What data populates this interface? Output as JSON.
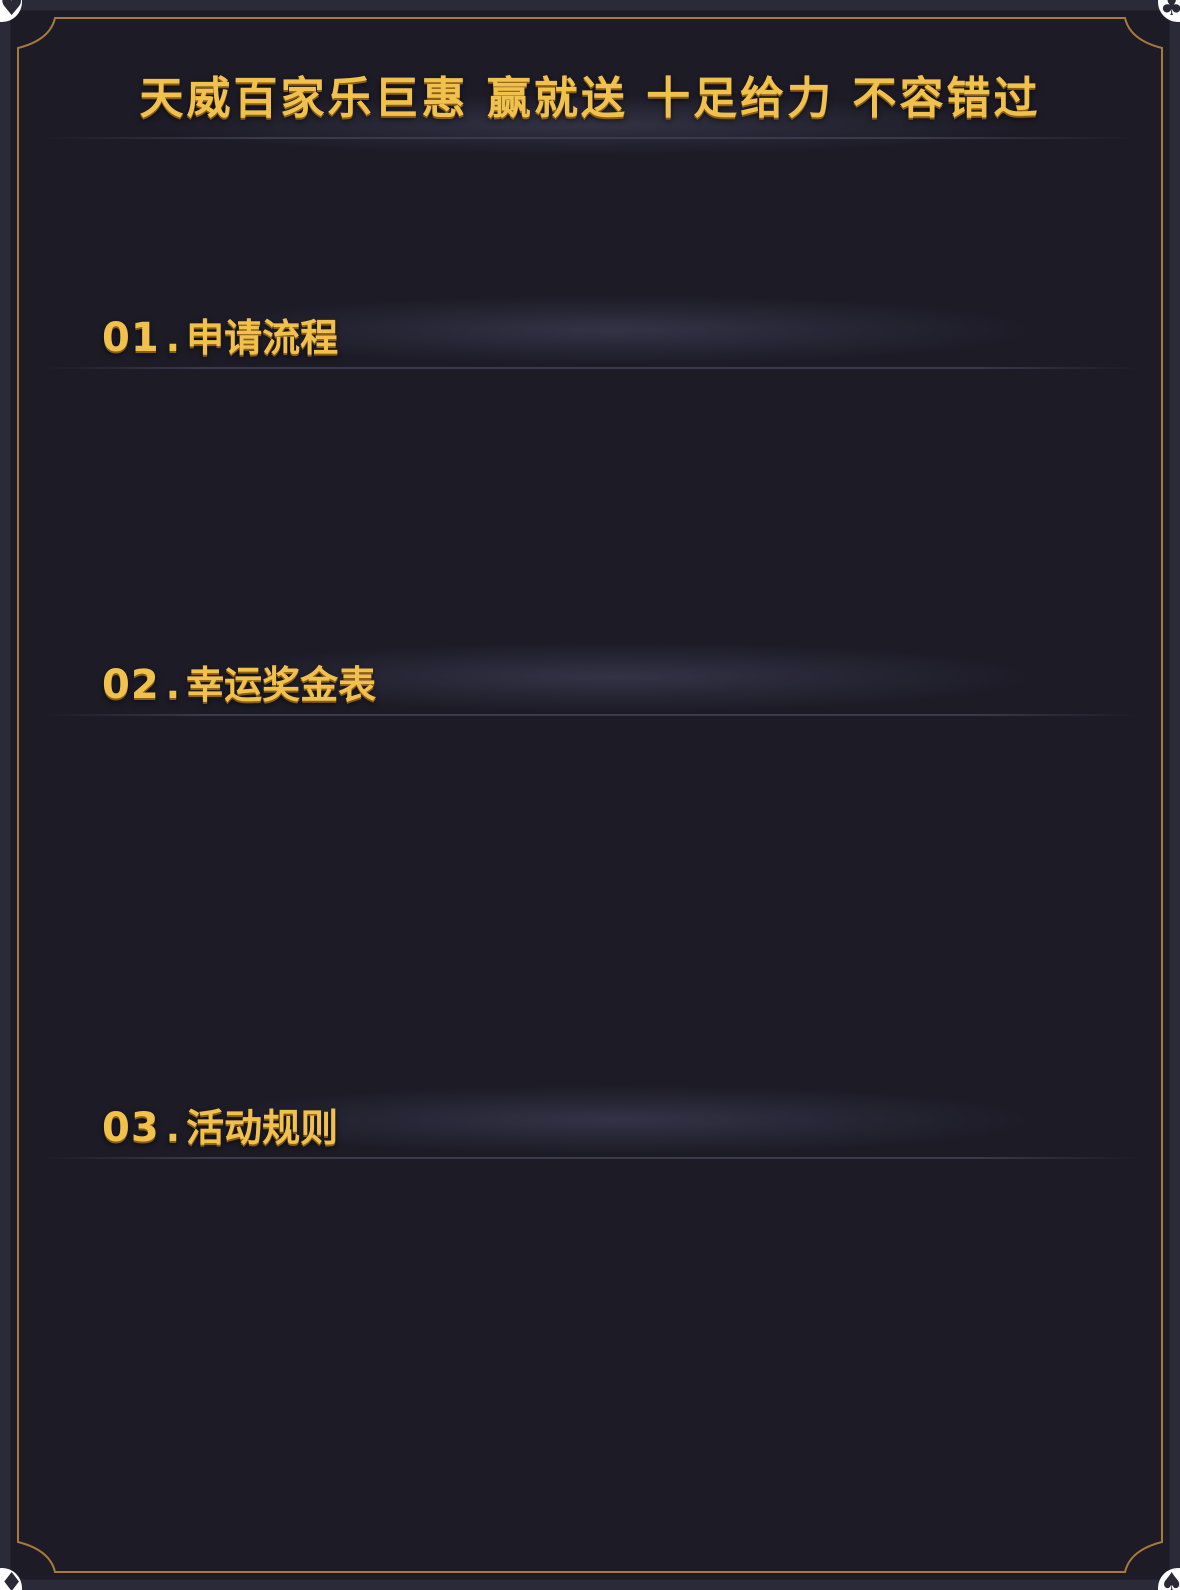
{
  "header": {
    "title": "天威百家乐巨惠  赢就送  十足给力  不容错过"
  },
  "corners": {
    "top_left": "♥",
    "top_right": "♣",
    "bottom_left": "♦",
    "bottom_right": "♠"
  },
  "sections": [
    {
      "number": "01",
      "separator": ".",
      "title": "申请流程"
    },
    {
      "number": "02",
      "separator": ".",
      "title": "幸运奖金表"
    },
    {
      "number": "03",
      "separator": ".",
      "title": "活动规则"
    }
  ],
  "colors": {
    "gold": "#f1c14e",
    "frame_gold": "#a8793a",
    "panel_bg": "#1c1b26",
    "outer_bg": "#2b2a38"
  }
}
